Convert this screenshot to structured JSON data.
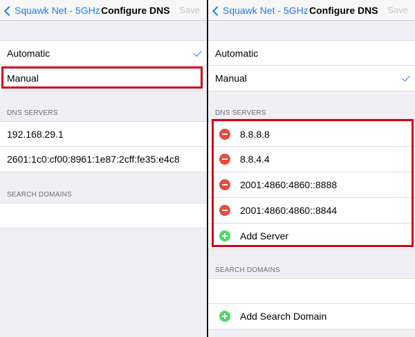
{
  "left": {
    "nav": {
      "back_label": "Squawk Net - 5GHz",
      "title": "Configure DNS",
      "save_label": "Save"
    },
    "options": {
      "automatic": "Automatic",
      "manual": "Manual"
    },
    "dns_header": "DNS SERVERS",
    "dns_servers": [
      "192.168.29.1",
      "2601:1c0:cf00:8961:1e87:2cff:fe35:e4c8"
    ],
    "search_header": "SEARCH DOMAINS"
  },
  "right": {
    "nav": {
      "back_label": "Squawk Net - 5GHz",
      "title": "Configure DNS",
      "save_label": "Save"
    },
    "options": {
      "automatic": "Automatic",
      "manual": "Manual"
    },
    "dns_header": "DNS SERVERS",
    "dns_servers": [
      "8.8.8.8",
      "8.8.4.4",
      "2001:4860:4860::8888",
      "2001:4860:4860::8844"
    ],
    "add_server": "Add Server",
    "search_header": "SEARCH DOMAINS",
    "add_search_domain": "Add Search Domain"
  },
  "colors": {
    "accent": "#1a7cf5",
    "highlight": "#d0021b",
    "delete": "#e74c3c",
    "add": "#4cd964"
  }
}
